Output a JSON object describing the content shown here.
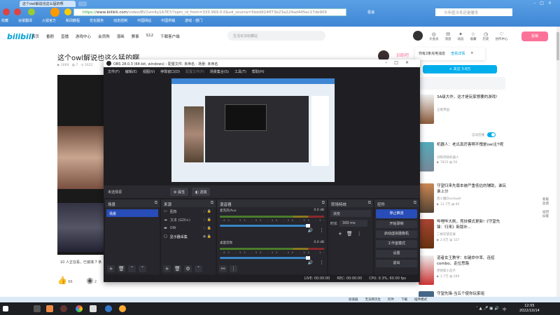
{
  "browser": {
    "tab_title": "这个owl解说也这么猛的啊",
    "address_scheme": "https://",
    "address_host": "www.bilibili.com",
    "address_path": "/video/BV1vm4y1A7E7/?spm_id_from=333.999.0.0&vd_source=5bdd924ff73b23a224ad445ec17de909",
    "quick_label": "极速",
    "search_placeholder": "今年医冷冬还是暖冬",
    "bookmarks": [
      "收藏",
      "谷歌翻译",
      "火狐官方",
      "新闻教程",
      "优化服务",
      "动态控制",
      "中国网站",
      "中国供销",
      "游戏 - 部门"
    ],
    "status_items": [
      "加速器",
      "无法网页生",
      "控件",
      "下载",
      "插件模式"
    ]
  },
  "bili": {
    "logo": "bilibili",
    "nav": [
      "首页",
      "番剧",
      "直播",
      "游戏中心",
      "会员购",
      "漫画",
      "赛事",
      "S12",
      "下载客户端"
    ],
    "search_placeholder": "生活买法收藏站",
    "user_icons": [
      {
        "icon": "◎",
        "label": "大会员"
      },
      {
        "icon": "✉",
        "label": "消息"
      },
      {
        "icon": "✦",
        "label": "动态"
      },
      {
        "icon": "☆",
        "label": "收藏"
      },
      {
        "icon": "◷",
        "label": "历史"
      },
      {
        "icon": "♡",
        "label": "创作中心"
      }
    ],
    "upload_label": "投稿"
  },
  "video": {
    "title": "这个owl解说也这么猛的啊",
    "views": "1669",
    "danmaku": "7",
    "date": "2022",
    "watching": "10 人正在看，已装填 7 条",
    "likes": "66",
    "coin": "2"
  },
  "up": {
    "name": "训练吧",
    "follow_label": "+ 关注 3.6万"
  },
  "toast": {
    "text": "你有2条充电消息",
    "link": "查看详情",
    "close": "×"
  },
  "autoplay_label": "自动连播",
  "recommend": [
    {
      "title": "3A级大作，这才是玩家想要的游戏!",
      "uploader": "正版帝国",
      "views": "",
      "comments": ""
    },
    {
      "title": "机器人：老瓜真厉害啊不愧是owl主T呢",
      "uploader": "训练吧啵机器人",
      "views": "7815",
      "comments": "50"
    },
    {
      "title": "守望归来先版本被严重低估的辅助，谁玩谁上分",
      "uploader": "西小魔Devilswill",
      "views": "12.7万",
      "comments": "60"
    },
    {
      "title": "哔哩哔大刷，竞技模式更新!《守望先锋：归来》新版补...",
      "uploader": "二柄守望先锋",
      "views": "2.6万",
      "comments": "327"
    },
    {
      "title": "道者女王教学：右键命中率、连招combo、走位思路",
      "uploader": "梦想家小蕊子",
      "views": "3.7万",
      "comments": "269"
    },
    {
      "title": "守望先锋-当五个使你玩家组",
      "uploader": "",
      "views": "",
      "comments": ""
    }
  ],
  "side_links": [
    "新版反馈",
    "返回旧版"
  ],
  "obs": {
    "title": "OBS 28.0.3 (64-bit, windows) - 配置文件: 未命名 - 场景: 未命名",
    "menu": [
      "文件(F)",
      "编辑(E)",
      "视图(V)",
      "停靠窗口(D)",
      "配置文件(P)",
      "场景集合(S)",
      "工具(T)",
      "帮助(H)"
    ],
    "no_source": "未选择源",
    "props_btn": "属性",
    "filters_btn": "滤镜",
    "docks": {
      "scenes": "场景",
      "sources": "来源",
      "mixer": "混音器",
      "transitions": "转场特效",
      "controls": "控件"
    },
    "scene_items": [
      "场景"
    ],
    "sources": [
      {
        "icon": "▭",
        "name": "图像"
      },
      {
        "icon": "☁",
        "name": "文本 (GDI+)"
      },
      {
        "icon": "▬",
        "name": "OW"
      },
      {
        "icon": "▢",
        "name": "显示器采集"
      }
    ],
    "mixer": [
      {
        "name": "麦克风/Aux",
        "db": "0.0 dB"
      },
      {
        "name": "桌面音频",
        "db": "0.0 dB"
      }
    ],
    "meter_ticks": "-60 -55 -50 -45 -40 -35 -30 -25 -20 -15 -10 -5 0",
    "transition": "渐变",
    "duration_label": "时长",
    "duration": "300 ms",
    "controls": [
      "停止推流",
      "开始录制",
      "启动虚拟摄像机",
      "工作室模式",
      "设置",
      "退出"
    ],
    "live": "LIVE: 00:00:00",
    "rec": "REC: 00:00:00",
    "cpu": "CPU: 0.3%, 60.00 fps"
  },
  "taskbar": {
    "time": "12:55",
    "date": "2022/10/14",
    "ime": "中"
  }
}
